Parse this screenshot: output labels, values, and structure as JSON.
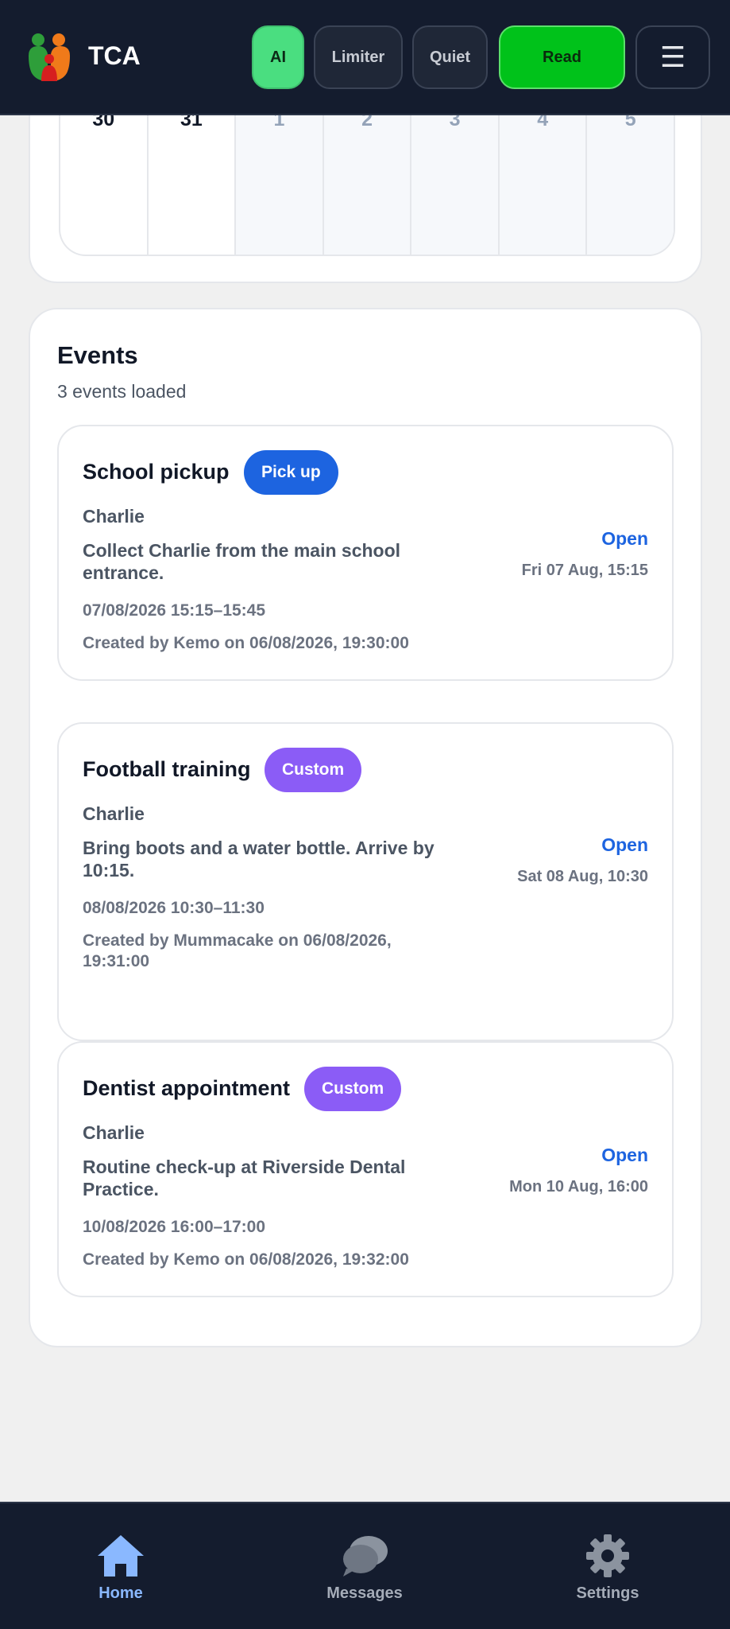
{
  "header": {
    "app_title": "TCA",
    "buttons": {
      "ai": "AI",
      "limiter": "Limiter",
      "quiet": "Quiet",
      "read": "Read",
      "menu": "☰"
    }
  },
  "calendar": {
    "days": [
      "30",
      "31",
      "1",
      "2",
      "3",
      "4",
      "5"
    ]
  },
  "events": {
    "title": "Events",
    "subtitle": "3 events loaded",
    "items": [
      {
        "title": "School pickup",
        "badge": "Pick up",
        "child": "Charlie",
        "description": "Collect Charlie from the main school entrance.",
        "time": "07/08/2026 15:15–15:45",
        "created": "Created by Kemo on 06/08/2026, 19:30:00",
        "status": "Open",
        "date": "Fri 07 Aug, 15:15"
      },
      {
        "title": "Football training",
        "badge": "Custom",
        "child": "Charlie",
        "description": "Bring boots and a water bottle. Arrive by 10:15.",
        "time": "08/08/2026 10:30–11:30",
        "created": "Created by Mummacake on 06/08/2026, 19:31:00",
        "status": "Open",
        "date": "Sat 08 Aug, 10:30"
      },
      {
        "title": "Dentist appointment",
        "badge": "Custom",
        "child": "Charlie",
        "description": "Routine check-up at Riverside Dental Practice.",
        "time": "10/08/2026 16:00–17:00",
        "created": "Created by Kemo on 06/08/2026, 19:32:00",
        "status": "Open",
        "date": "Mon 10 Aug, 16:00"
      }
    ]
  },
  "nav": {
    "home": "Home",
    "messages": "Messages",
    "settings": "Settings"
  },
  "colors": {
    "header_bg": "#141c2e",
    "accent_blue": "#1d64e0",
    "badge_custom": "#8b5cf6",
    "ai_green": "#4ade80",
    "read_green": "#00c21a",
    "nav_active": "#8ab8ff"
  }
}
